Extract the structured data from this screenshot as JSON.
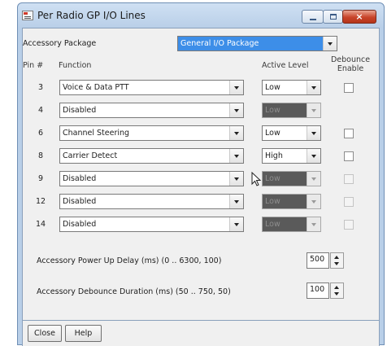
{
  "window": {
    "title": "Per Radio GP I/O Lines",
    "close_glyph": "×"
  },
  "accessory": {
    "label": "Accessory Package",
    "value": "General I/O Package"
  },
  "headers": {
    "pin": "Pin #",
    "function": "Function",
    "active_level": "Active Level",
    "debounce_line1": "Debounce",
    "debounce_line2": "Enable"
  },
  "rows": [
    {
      "pin": "3",
      "function": "Voice & Data PTT",
      "level": "Low",
      "level_enabled": true,
      "debounce_shown": true,
      "debounce_checked": false
    },
    {
      "pin": "4",
      "function": "Disabled",
      "level": "Low",
      "level_enabled": false,
      "debounce_shown": false,
      "debounce_checked": false
    },
    {
      "pin": "6",
      "function": "Channel Steering",
      "level": "Low",
      "level_enabled": true,
      "debounce_shown": true,
      "debounce_checked": false
    },
    {
      "pin": "8",
      "function": "Carrier Detect",
      "level": "High",
      "level_enabled": true,
      "debounce_shown": true,
      "debounce_checked": false
    },
    {
      "pin": "9",
      "function": "Disabled",
      "level": "Low",
      "level_enabled": false,
      "debounce_shown": true,
      "debounce_checked": false
    },
    {
      "pin": "12",
      "function": "Disabled",
      "level": "Low",
      "level_enabled": false,
      "debounce_shown": true,
      "debounce_checked": false
    },
    {
      "pin": "14",
      "function": "Disabled",
      "level": "Low",
      "level_enabled": false,
      "debounce_shown": true,
      "debounce_checked": false
    }
  ],
  "power_up": {
    "label": "Accessory Power Up Delay (ms) (0 .. 6300, 100)",
    "value": "500"
  },
  "debounce_duration": {
    "label": "Accessory Debounce Duration (ms) (50 .. 750, 50)",
    "value": "100"
  },
  "buttons": {
    "close": "Close",
    "help": "Help"
  },
  "icons": {
    "app": "radio-app-icon",
    "minimize": "minimize-icon",
    "maximize": "maximize-icon",
    "close": "close-icon",
    "dropdown": "chevron-down-icon",
    "spin_up": "spin-up-icon",
    "spin_down": "spin-down-icon",
    "cursor": "mouse-pointer-icon"
  },
  "colors": {
    "titlebar": "#b9cfe8",
    "close_button": "#c8442a",
    "selected_combo": "#3d8ee8",
    "disabled_combo": "#5a5a5a",
    "dialog_bg": "#f0f0f0"
  }
}
